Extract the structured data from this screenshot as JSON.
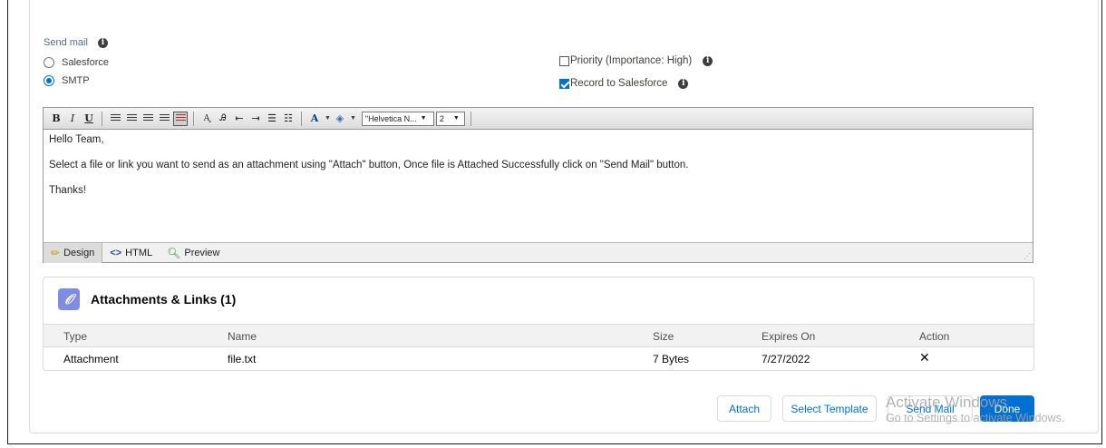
{
  "send_mail": {
    "label": "Send mail",
    "info_icon": "info-icon",
    "options": [
      {
        "label": "Salesforce",
        "selected": false
      },
      {
        "label": "SMTP",
        "selected": true
      }
    ]
  },
  "checkboxes": [
    {
      "label": "Priority (Importance: High)",
      "checked": false
    },
    {
      "label": "Record to Salesforce",
      "checked": true
    }
  ],
  "editor": {
    "toolbar": {
      "bold": "B",
      "italic": "I",
      "underline": "U",
      "font_name": "\"Helvetica N...",
      "font_size": "2",
      "font_color": "A"
    },
    "body": {
      "greeting": "Hello Team,",
      "line": "Select a file or link you want to send as an attachment using \"Attach\" button, Once file is Attached Successfully click on \"Send Mail\" button.",
      "closing": "Thanks!"
    },
    "tabs": [
      {
        "label": "Design",
        "active": true
      },
      {
        "label": "HTML",
        "active": false
      },
      {
        "label": "Preview",
        "active": false
      }
    ]
  },
  "attachments": {
    "title": "Attachments & Links (1)",
    "columns": [
      "Type",
      "Name",
      "Size",
      "Expires On",
      "Action"
    ],
    "rows": [
      {
        "type": "Attachment",
        "name": "file.txt",
        "size": "7 Bytes",
        "expires": "7/27/2022",
        "action": "✕"
      }
    ]
  },
  "buttons": {
    "attach": "Attach",
    "select_template": "Select Template",
    "send_mail": "Send Mail",
    "done": "Done"
  },
  "watermark": {
    "line1": "Activate Windows",
    "line2": "Go to Settings to activate Windows."
  },
  "colors": {
    "brand": "#0070d2",
    "attach_icon_bg": "#7f8de1"
  }
}
